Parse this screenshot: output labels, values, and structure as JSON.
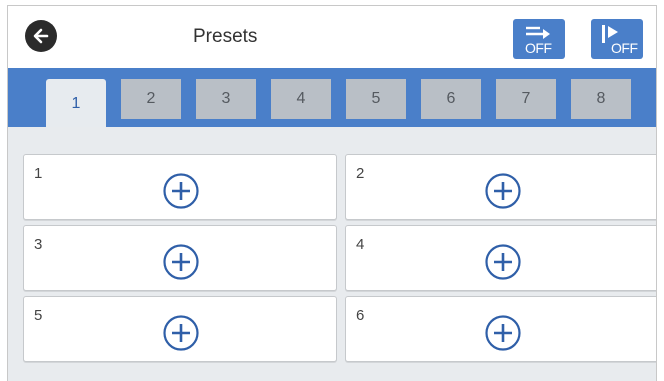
{
  "header": {
    "title": "Presets",
    "button_one_label": "OFF",
    "button_two_label": "OFF"
  },
  "tabs": [
    "1",
    "2",
    "3",
    "4",
    "5",
    "6",
    "7",
    "8"
  ],
  "active_tab": "1",
  "presets": [
    "1",
    "2",
    "3",
    "4",
    "5",
    "6"
  ],
  "colors": {
    "accent": "#4a7fc9",
    "tab_inactive": "#b9bfc6",
    "content_bg": "#e8ebee",
    "plus_icon": "#2f5fa8"
  },
  "icons": {
    "back": "back-arrow-icon",
    "button_one": "skip-arrow-icon",
    "button_two": "play-skip-icon",
    "add": "add-circle-icon"
  }
}
